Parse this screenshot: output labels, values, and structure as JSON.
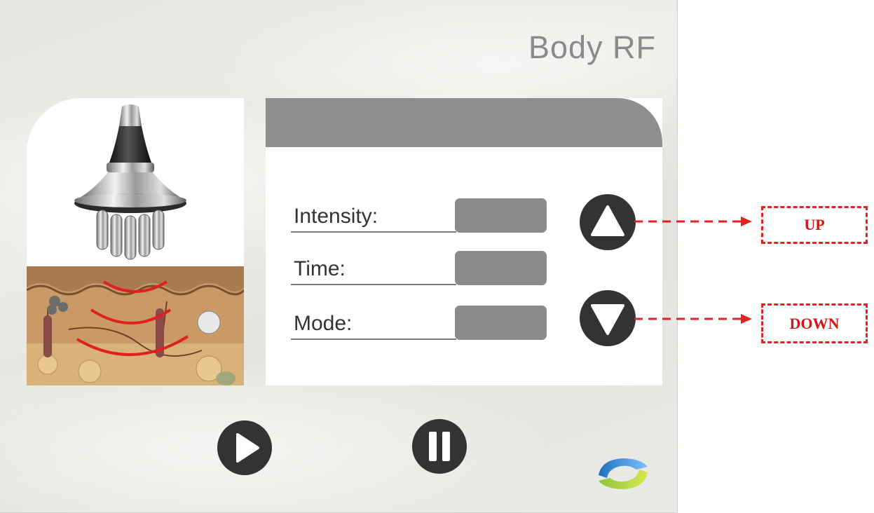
{
  "screen": {
    "title": "Body RF"
  },
  "parameters": [
    {
      "label": "Intensity:",
      "value": ""
    },
    {
      "label": "Time:",
      "value": ""
    },
    {
      "label": "Mode:",
      "value": ""
    }
  ],
  "icons": {
    "up": "triangle-up-icon",
    "down": "triangle-down-icon",
    "play": "play-icon",
    "pause": "pause-icon",
    "logo": "brand-logo"
  },
  "callouts": {
    "up": "UP",
    "down": "DOWN"
  },
  "colors": {
    "background": "#e8e8e4",
    "panel_header": "#8f8f8f",
    "value_box": "#8a8a8a",
    "button": "#333333",
    "title": "#8a8a8a",
    "callout": "#e32222"
  }
}
